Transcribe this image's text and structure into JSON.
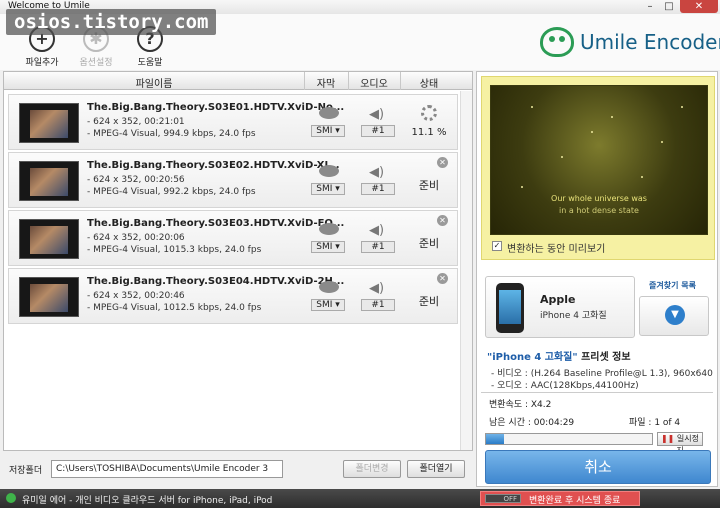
{
  "window": {
    "title": "Welcome to Umile",
    "min": "–",
    "max": "□",
    "close": "✕"
  },
  "watermark": "osios.tistory.com",
  "toolbar": {
    "add_label": "파일추가",
    "options_label": "옵션설정",
    "help_label": "도움말"
  },
  "logo": {
    "text": "Umile Encoder"
  },
  "list": {
    "headers": {
      "filename": "파일이름",
      "subtitle": "자막",
      "audio": "오디오",
      "status": "상태"
    },
    "rows": [
      {
        "name": "The.Big.Bang.Theory.S03E01.HDTV.XviD-No...",
        "res": "- 624 x 352, 00:21:01",
        "codec": "- MPEG-4 Visual, 994.9 kbps, 24.0 fps",
        "sub": "SMI ▾",
        "audio": "#1",
        "status": "11.1 %"
      },
      {
        "name": "The.Big.Bang.Theory.S03E02.HDTV.XviD-XI...",
        "res": "- 624 x 352, 00:20:56",
        "codec": "- MPEG-4 Visual, 992.2 kbps, 24.0 fps",
        "sub": "SMI ▾",
        "audio": "#1",
        "status": "준비"
      },
      {
        "name": "The.Big.Bang.Theory.S03E03.HDTV.XviD-FQ...",
        "res": "- 624 x 352, 00:20:06",
        "codec": "- MPEG-4 Visual, 1015.3 kbps, 24.0 fps",
        "sub": "SMI ▾",
        "audio": "#1",
        "status": "준비"
      },
      {
        "name": "The.Big.Bang.Theory.S03E04.HDTV.XviD-2H...",
        "res": "- 624 x 352, 00:20:46",
        "codec": "- MPEG-4 Visual, 1012.5 kbps, 24.0 fps",
        "sub": "SMI ▾",
        "audio": "#1",
        "status": "준비"
      }
    ]
  },
  "save": {
    "label": "저장폴더",
    "path": "C:\\Users\\TOSHIBA\\Documents\\Umile Encoder 3",
    "change_label": "폴더변경",
    "open_label": "폴더열기"
  },
  "preview": {
    "sub_line1": "Our whole universe was",
    "sub_line2": "in a hot dense state",
    "check_label": "변환하는 동안 미리보기",
    "checked": true
  },
  "device": {
    "brand": "Apple",
    "model": "iPhone 4 고화질",
    "fav_label": "즐겨찾기 목록"
  },
  "preset": {
    "name": "\"iPhone 4 고화질\"",
    "suffix": " 프리셋 정보",
    "video": "- 비디오 : (H.264 Baseline Profile@L 1.3), 960x640",
    "audio": "- 오디오 : AAC(128Kbps,44100Hz)"
  },
  "progress": {
    "speed": "변환속도 : X4.2",
    "remaining": "남은 시간 : 00:04:29",
    "files": "파일 : 1 of 4",
    "fraction": 0.111,
    "pause_label": "일시정지",
    "cancel_label": "취소"
  },
  "statusbar": {
    "message": "유미일 에어 - 개인 비디오 클라우드 서버 for iPhone, iPad, iPod",
    "toggle_label": "OFF",
    "shutdown_label": "변환완료 후 시스템 종료"
  },
  "colors": {
    "accent": "#3f87cf",
    "close": "#c94540",
    "preview_bg": "#f6f1a3",
    "shutdown": "#e05050"
  }
}
